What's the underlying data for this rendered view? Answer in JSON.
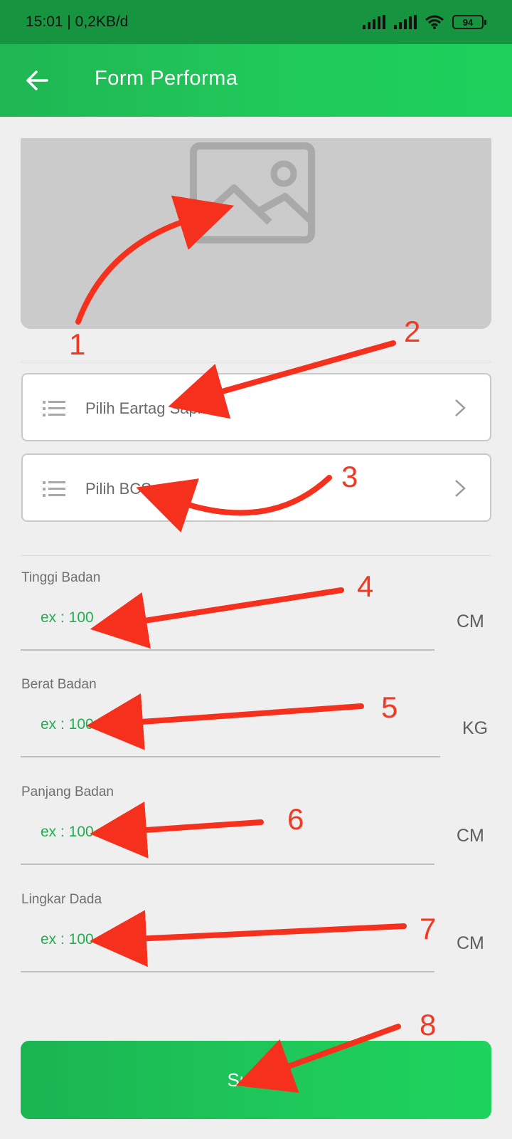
{
  "status_bar": {
    "time_speed": "15:01 | 0,2KB/d",
    "battery": "94"
  },
  "app_bar": {
    "title": "Form Performa"
  },
  "selects": [
    {
      "label": "Pilih Eartag Sapi"
    },
    {
      "label": "Pilih BCS"
    }
  ],
  "fields": [
    {
      "label": "Tinggi Badan",
      "placeholder": "ex : 100",
      "unit": "CM"
    },
    {
      "label": "Berat Badan",
      "placeholder": "ex : 100",
      "unit": "KG"
    },
    {
      "label": "Panjang Badan",
      "placeholder": "ex : 100",
      "unit": "CM"
    },
    {
      "label": "Lingkar Dada",
      "placeholder": "ex : 100",
      "unit": "CM"
    }
  ],
  "submit": {
    "label": "Submit"
  },
  "annotations": [
    "1",
    "2",
    "3",
    "4",
    "5",
    "6",
    "7",
    "8"
  ],
  "colors": {
    "accent": "#1ec95a",
    "status_bar": "#16943f",
    "annotation": "#f03a26"
  }
}
